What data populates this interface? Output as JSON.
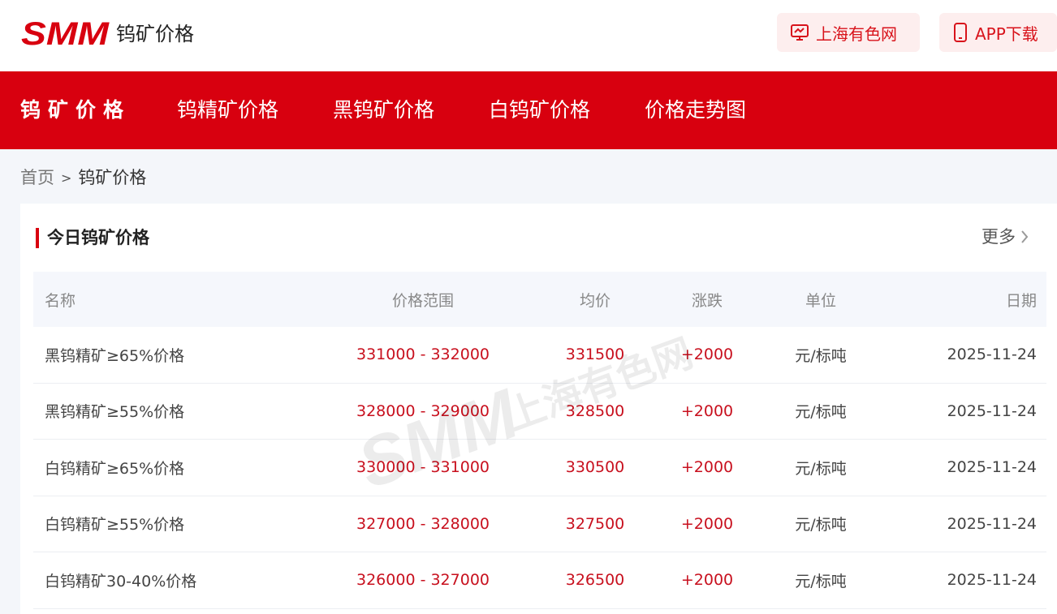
{
  "header": {
    "logo_text": "SMM",
    "site_name": "钨矿价格",
    "smm_button": "上海有色网",
    "app_button": "APP下载"
  },
  "nav": {
    "items": [
      {
        "label": "钨矿价格"
      },
      {
        "label": "钨精矿价格"
      },
      {
        "label": "黑钨矿价格"
      },
      {
        "label": "白钨矿价格"
      },
      {
        "label": "价格走势图"
      }
    ],
    "active_index": 0
  },
  "breadcrumb": {
    "home": "首页",
    "separator": ">",
    "current": "钨矿价格"
  },
  "section": {
    "title": "今日钨矿价格",
    "more_label": "更多"
  },
  "table": {
    "headers": {
      "name": "名称",
      "range": "价格范围",
      "avg": "均价",
      "change": "涨跌",
      "unit": "单位",
      "date": "日期"
    },
    "rows": [
      {
        "name": "黑钨精矿≥65%价格",
        "range": "331000 - 332000",
        "avg": "331500",
        "change": "+2000",
        "unit": "元/标吨",
        "date": "2025-11-24"
      },
      {
        "name": "黑钨精矿≥55%价格",
        "range": "328000 - 329000",
        "avg": "328500",
        "change": "+2000",
        "unit": "元/标吨",
        "date": "2025-11-24"
      },
      {
        "name": "白钨精矿≥65%价格",
        "range": "330000 - 331000",
        "avg": "330500",
        "change": "+2000",
        "unit": "元/标吨",
        "date": "2025-11-24"
      },
      {
        "name": "白钨精矿≥55%价格",
        "range": "327000 - 328000",
        "avg": "327500",
        "change": "+2000",
        "unit": "元/标吨",
        "date": "2025-11-24"
      },
      {
        "name": "白钨精矿30-40%价格",
        "range": "326000 - 327000",
        "avg": "326500",
        "change": "+2000",
        "unit": "元/标吨",
        "date": "2025-11-24"
      }
    ]
  },
  "watermark": {
    "logo_text": "SMM",
    "text": "上海有色网"
  },
  "colors": {
    "brand_red": "#d8000f",
    "price_red": "#c8101e",
    "button_bg": "#fdeeee",
    "page_bg": "#f4f6fa"
  }
}
